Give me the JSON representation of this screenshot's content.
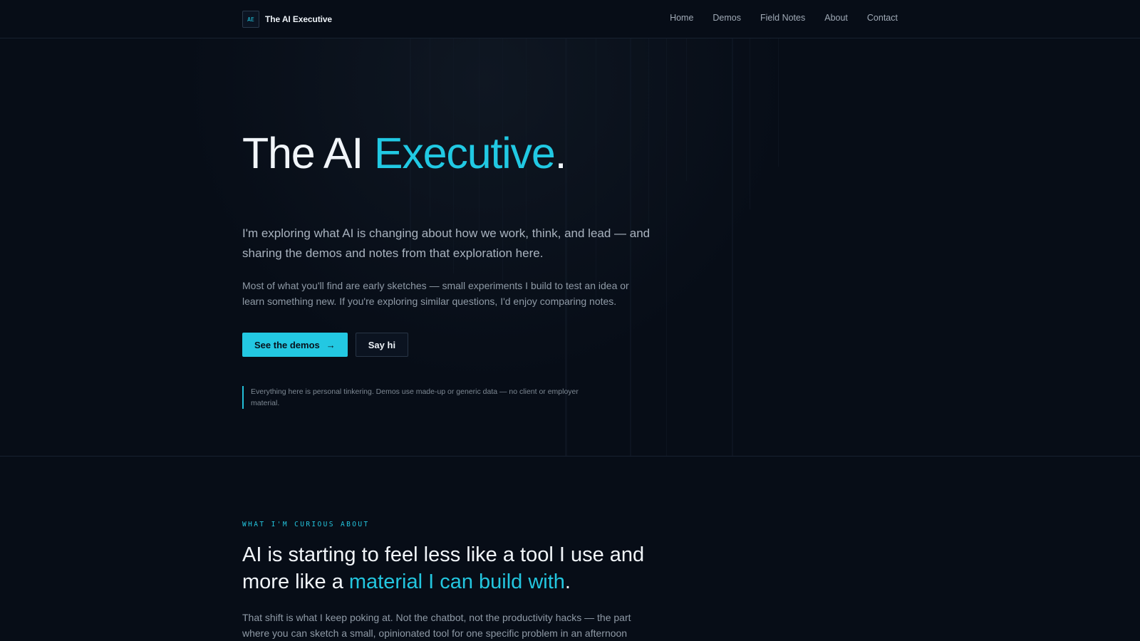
{
  "header": {
    "logo_text": "AE",
    "brand_name": "The AI Executive",
    "nav": [
      {
        "label": "Home"
      },
      {
        "label": "Demos"
      },
      {
        "label": "Field Notes"
      },
      {
        "label": "About"
      },
      {
        "label": "Contact"
      }
    ]
  },
  "hero": {
    "title_prefix": "The AI ",
    "title_accent": "Executive",
    "title_suffix": ".",
    "lede": "I'm exploring what AI is changing about how we work, think, and lead — and sharing the demos and notes from that exploration here.",
    "body": "Most of what you'll find are early sketches — small experiments I build to test an idea or learn something new. If you're exploring similar questions, I'd enjoy comparing notes.",
    "primary_cta": "See the demos",
    "secondary_cta": "Say hi",
    "disclaimer": "Everything here is personal tinkering. Demos use made-up or generic data — no client or employer material."
  },
  "curiosity": {
    "eyebrow": "WHAT I'M CURIOUS ABOUT",
    "heading_prefix": "AI is starting to feel less like a tool I use and more like a ",
    "heading_accent": "material I can build with",
    "heading_suffix": ".",
    "body": "That shift is what I keep poking at. Not the chatbot, not the productivity hacks — the part where you can sketch a small, opinionated tool for one specific problem in an afternoon"
  },
  "colors": {
    "background": "#070d17",
    "accent": "#23c8e2",
    "text_primary": "#f1f5f9",
    "text_secondary": "#8f9aa6",
    "border": "#172130"
  },
  "icons": {
    "primary_cta_icon": "arrow-right-icon"
  }
}
